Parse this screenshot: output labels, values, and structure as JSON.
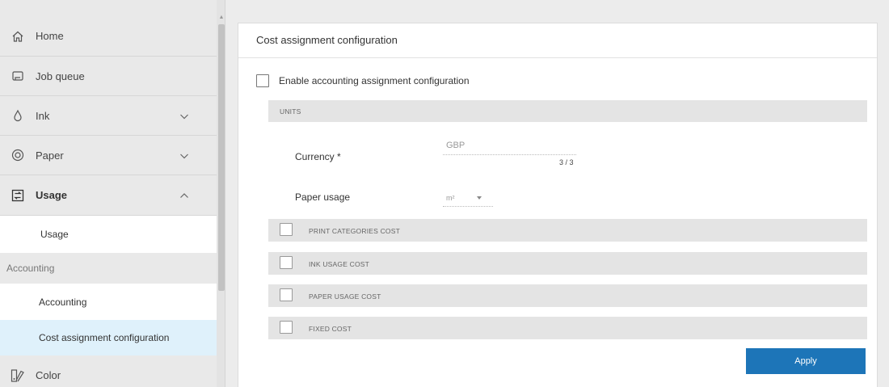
{
  "sidebar": {
    "items": [
      {
        "label": "Home",
        "icon": "home-icon"
      },
      {
        "label": "Job queue",
        "icon": "job-queue-icon"
      },
      {
        "label": "Ink",
        "icon": "ink-drop-icon",
        "expanded": false
      },
      {
        "label": "Paper",
        "icon": "paper-roll-icon",
        "expanded": false
      },
      {
        "label": "Usage",
        "icon": "usage-icon",
        "expanded": true
      }
    ],
    "usage_sub": "Usage",
    "accounting_section": "Accounting",
    "accounting_sub": "Accounting",
    "cost_assignment_sub": "Cost assignment configuration",
    "color_item": {
      "label": "Color",
      "icon": "color-icon"
    }
  },
  "panel": {
    "title": "Cost assignment configuration",
    "enable_label": "Enable accounting assignment configuration",
    "enable_checked": false,
    "units_header": "UNITS",
    "currency_label": "Currency *",
    "currency_value": "GBP",
    "currency_counter": "3 / 3",
    "paper_usage_label": "Paper usage",
    "paper_usage_value": "m²",
    "cost_sections": [
      {
        "label": "PRINT CATEGORIES COST",
        "checked": false
      },
      {
        "label": "INK USAGE COST",
        "checked": false
      },
      {
        "label": "PAPER USAGE COST",
        "checked": false
      },
      {
        "label": "FIXED COST",
        "checked": false
      }
    ],
    "apply_label": "Apply"
  },
  "colors": {
    "accent": "#1d75b8",
    "selected_bg": "#dff1fb",
    "sidebar_bg": "#e9e9e9",
    "section_bar": "#e4e4e4"
  }
}
